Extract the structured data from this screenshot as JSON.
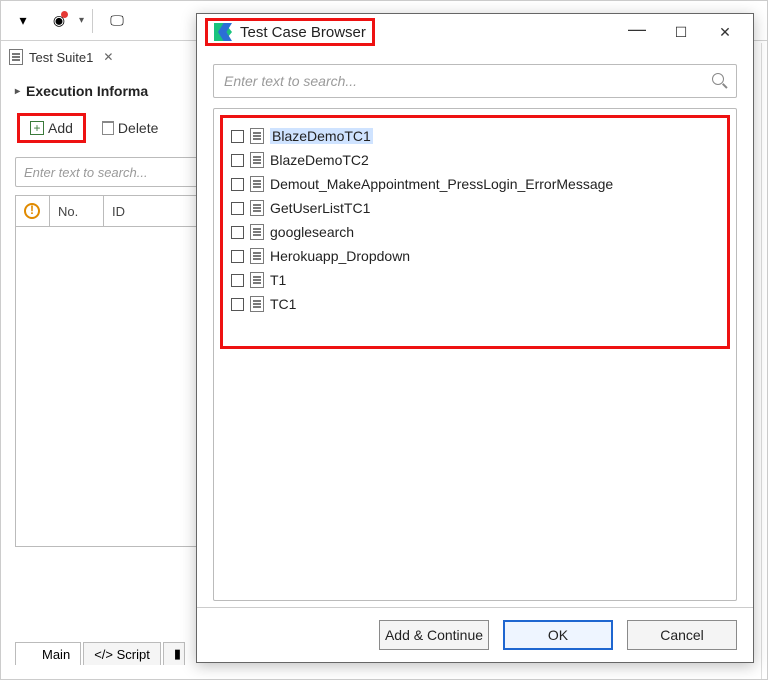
{
  "toolbar": {},
  "editor": {
    "tab_label": "Test Suite1",
    "section_label": "Execution Informa",
    "add_label": "Add",
    "delete_label": "Delete",
    "search_placeholder": "Enter text to search...",
    "columns": {
      "no": "No.",
      "id": "ID"
    },
    "bottom_tabs": {
      "main": "Main",
      "script": "</>  Script"
    }
  },
  "dialog": {
    "title": "Test Case Browser",
    "search_placeholder": "Enter text to search...",
    "items": [
      "BlazeDemoTC1",
      "BlazeDemoTC2",
      "Demout_MakeAppointment_PressLogin_ErrorMessage",
      "GetUserListTC1",
      "googlesearch",
      "Herokuapp_Dropdown",
      "T1",
      "TC1"
    ],
    "buttons": {
      "add_continue": "Add & Continue",
      "ok": "OK",
      "cancel": "Cancel"
    }
  }
}
